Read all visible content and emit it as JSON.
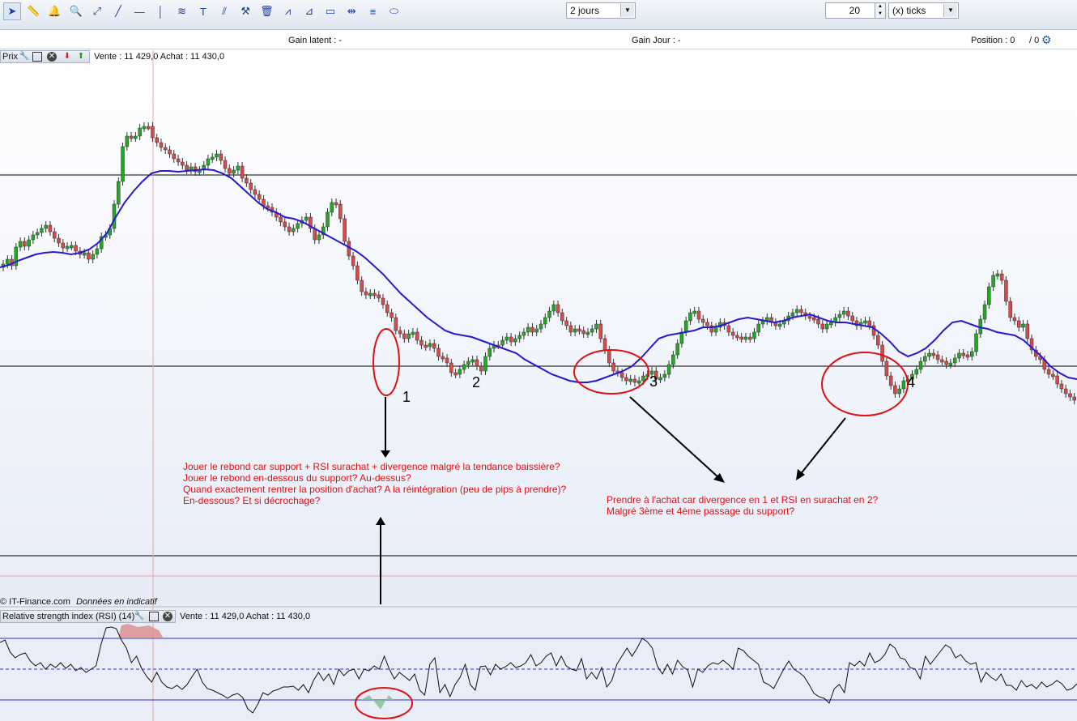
{
  "toolbar": {
    "icons": [
      "cursor-icon",
      "ruler-icon",
      "alarm-bell-icon",
      "zoom-icon",
      "line-tool-icon",
      "trend-line-icon",
      "horizontal-line-icon",
      "vertical-line-icon",
      "fibonacci-icon",
      "text-tool-icon",
      "parallel-line-icon",
      "tools-icon",
      "trash-icon",
      "zigzag-icon",
      "triangle-icon",
      "rectangle-icon",
      "measure-icon",
      "fan-icon",
      "ellipse-icon"
    ],
    "period": "2 jours",
    "ticks_value": "20",
    "ticks_unit": "(x) ticks"
  },
  "info": {
    "gain_latent": "Gain latent : -",
    "gain_jour": "Gain Jour : -",
    "position_label": "Position : 0",
    "position_value": "/ 0"
  },
  "price_panel": {
    "label": "Prix",
    "quote": "Vente : 11 429,0 Achat : 11 430,0"
  },
  "rsi_panel": {
    "label": "Relative strength index (RSI) (14)",
    "quote": "Vente : 11 429,0 Achat : 11 430,0"
  },
  "watermark": {
    "source": "© IT-Finance.com",
    "note": "Données en indicatif"
  },
  "colors": {
    "up": "#22a822",
    "down": "#d84a4a",
    "ma": "#2a18d0",
    "annotation": "#e01010",
    "rsi": "#111111"
  },
  "annotations": {
    "markers": [
      "1",
      "2",
      "3",
      "4"
    ],
    "left_note": [
      "Jouer le rebond car support + RSI surachat + divergence malgré la tendance baissière?",
      "Jouer le rebond en-dessous du support? Au-dessus?",
      " Quand exactement rentrer la position d'achat? A la réintégration (peu de pips à prendre)?",
      " En-dessous? Et si décrochage?"
    ],
    "right_note": [
      "Prendre à l'achat car divergence en 1 et RSI en surachat en 2?",
      "Malgré 3ème et 4ème passage du support?"
    ]
  },
  "chart_data": [
    {
      "type": "candlestick",
      "series": [
        {
          "name": "price",
          "values": [
            326,
            320,
            328,
            305,
            298,
            304,
            296,
            290,
            287,
            282,
            278,
            286,
            294,
            300,
            306,
            304,
            303,
            310,
            314,
            312,
            320,
            314,
            307,
            292,
            290,
            282,
            252,
            224,
            181,
            168,
            170,
            168,
            158,
            156,
            156,
            170,
            176,
            182,
            185,
            190,
            196,
            200,
            204,
            210,
            206,
            212,
            210,
            204,
            196,
            194,
            190,
            198,
            208,
            214,
            210,
            205,
            220,
            226,
            234,
            240,
            246,
            254,
            256,
            262,
            268,
            274,
            280,
            286,
            282,
            276,
            272,
            268,
            282,
            296,
            290,
            280,
            262,
            250,
            252,
            270,
            298,
            316,
            328,
            346,
            360,
            364,
            362,
            364,
            368,
            376,
            386,
            392,
            408,
            412,
            418,
            412,
            410,
            420,
            426,
            428,
            424,
            430,
            440,
            442,
            448,
            460,
            462,
            456,
            450,
            446,
            444,
            452,
            458,
            440,
            430,
            426,
            426,
            420,
            416,
            422,
            418,
            414,
            410,
            404,
            410,
            406,
            400,
            392,
            384,
            376,
            386,
            396,
            402,
            410,
            406,
            408,
            412,
            410,
            406,
            400,
            418,
            432,
            448,
            458,
            460,
            466,
            470,
            468,
            472,
            470,
            464,
            462,
            458,
            468,
            466,
            462,
            450,
            438,
            424,
            410,
            396,
            386,
            384,
            394,
            398,
            402,
            410,
            404,
            398,
            402,
            410,
            414,
            416,
            418,
            416,
            418,
            410,
            400,
            396,
            392,
            398,
            402,
            400,
            396,
            390,
            386,
            382,
            386,
            390,
            392,
            394,
            400,
            406,
            400,
            398,
            392,
            388,
            384,
            390,
            396,
            402,
            398,
            396,
            402,
            414,
            426,
            446,
            464,
            476,
            486,
            480,
            470,
            468,
            462,
            456,
            446,
            440,
            436,
            438,
            444,
            446,
            450,
            448,
            442,
            436,
            438,
            440,
            434,
            412,
            394,
            376,
            354,
            340,
            338,
            346,
            372,
            392,
            396,
            404,
            400,
            418,
            432,
            440,
            444,
            456,
            462,
            464,
            474,
            480,
            486,
            490,
            494
          ]
        },
        {
          "name": "moving-average",
          "values": [
            330,
            327,
            322,
            318,
            314,
            312,
            311,
            312,
            314,
            312,
            308,
            300,
            288,
            268,
            250,
            236,
            224,
            214,
            211,
            211,
            212,
            211,
            210,
            209,
            210,
            214,
            220,
            230,
            240,
            250,
            258,
            262,
            268,
            270,
            274,
            280,
            286,
            292,
            298,
            304,
            310,
            318,
            328,
            338,
            350,
            362,
            372,
            382,
            392,
            400,
            408,
            412,
            414,
            416,
            420,
            424,
            428,
            432,
            436,
            444,
            450,
            456,
            462,
            466,
            470,
            472,
            472,
            470,
            466,
            462,
            458,
            452,
            442,
            430,
            418,
            414,
            412,
            410,
            408,
            404,
            404,
            402,
            398,
            394,
            392,
            394,
            396,
            398,
            396,
            392,
            390,
            388,
            392,
            396,
            398,
            398,
            400,
            402,
            404,
            412,
            422,
            434,
            440,
            436,
            430,
            420,
            408,
            398,
            396,
            400,
            404,
            406,
            410,
            412,
            414,
            420,
            430,
            440,
            452,
            460,
            466,
            468
          ]
        }
      ]
    },
    {
      "type": "line",
      "series": [
        {
          "name": "RSI",
          "values": [
            793,
            790,
            805,
            812,
            808,
            806,
            816,
            822,
            818,
            826,
            820,
            824,
            818,
            825,
            820,
            828,
            824,
            830,
            826,
            822,
            795,
            775,
            774,
            776,
            790,
            800,
            818,
            810,
            825,
            835,
            842,
            830,
            842,
            848,
            850,
            846,
            851,
            845,
            835,
            826,
            842,
            850,
            852,
            855,
            858,
            862,
            858,
            856,
            861,
            875,
            880,
            869,
            855,
            858,
            853,
            851,
            848,
            848,
            847,
            852,
            845,
            855,
            840,
            830,
            840,
            832,
            845,
            826,
            834,
            828,
            826,
            838,
            826,
            828,
            822,
            826,
            810,
            826,
            838,
            830,
            835,
            840,
            832,
            852,
            858,
            820,
            812,
            855,
            845,
            860,
            845,
            836,
            820,
            845,
            852,
            823,
            822,
            833,
            820,
            826,
            823,
            818,
            824,
            822,
            818,
            808,
            822,
            818,
            810,
            806,
            822,
            810,
            822,
            826,
            828,
            813,
            838,
            830,
            838,
            824,
            848,
            840,
            820,
            810,
            800,
            810,
            800,
            788,
            792,
            800,
            822,
            832,
            820,
            832,
            815,
            823,
            827,
            848,
            826,
            830,
            822,
            818,
            820,
            815,
            820,
            826,
            800,
            803,
            810,
            815,
            820,
            842,
            845,
            850,
            838,
            826,
            816,
            826,
            830,
            835,
            845,
            856,
            860,
            862,
            868,
            850,
            845,
            855,
            818,
            822,
            816,
            822,
            806,
            818,
            815,
            808,
            795,
            800,
            812,
            814,
            824,
            826,
            838,
            810,
            820,
            812,
            804,
            796,
            800,
            812,
            808,
            816,
            820,
            818,
            842,
            830,
            836,
            840,
            832,
            846,
            846,
            852,
            840,
            848,
            845,
            850,
            842,
            848,
            845,
            840,
            844,
            852,
            850,
            844
          ]
        }
      ],
      "hlines": [
        788,
        826,
        864
      ]
    }
  ]
}
